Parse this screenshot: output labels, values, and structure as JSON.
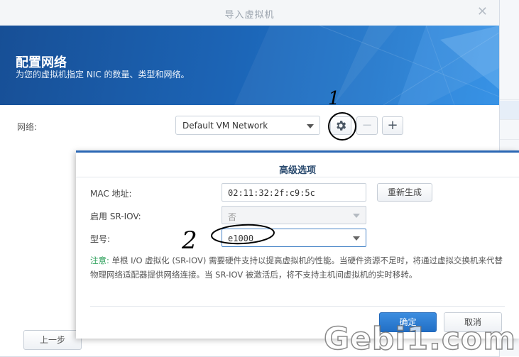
{
  "dialog": {
    "title": "导入虚拟机",
    "close_glyph": "✕",
    "banner": {
      "heading": "配置网络",
      "subheading": "为您的虚拟机指定 NIC 的数量、类型和网络。"
    },
    "network": {
      "label": "网络:",
      "selected": "Default VM Network"
    },
    "prev_button": "上一步",
    "icons": [
      "gear-icon",
      "minus-icon",
      "plus-icon",
      "close-icon"
    ]
  },
  "advanced": {
    "title": "高级选项",
    "mac_label": "MAC 地址:",
    "mac_value": "02:11:32:2f:c9:5c",
    "regenerate_button": "重新生成",
    "sriov_label": "启用 SR-IOV:",
    "sriov_value": "否",
    "model_label": "型号:",
    "model_value": "e1000",
    "note_lead": "注意:",
    "note_text": "单根 I/O 虚拟化 (SR-IOV) 需要硬件支持以提高虚拟机的性能。当硬件资源不足时，将通过虚拟交换机来代替物理网络适配器提供网络连接。当 SR-IOV 被激活后，将不支持主机间虚拟机的实时移转。",
    "ok_button": "确定",
    "cancel_button": "取消"
  },
  "annotations": {
    "mark_1": "1",
    "mark_2": "2"
  },
  "watermark": "Gebi1.com",
  "colors": {
    "accent": "#2b67b4",
    "banner": "#1c64b5",
    "note_lead": "#2fa15c",
    "annotation_ink": "#000000"
  }
}
